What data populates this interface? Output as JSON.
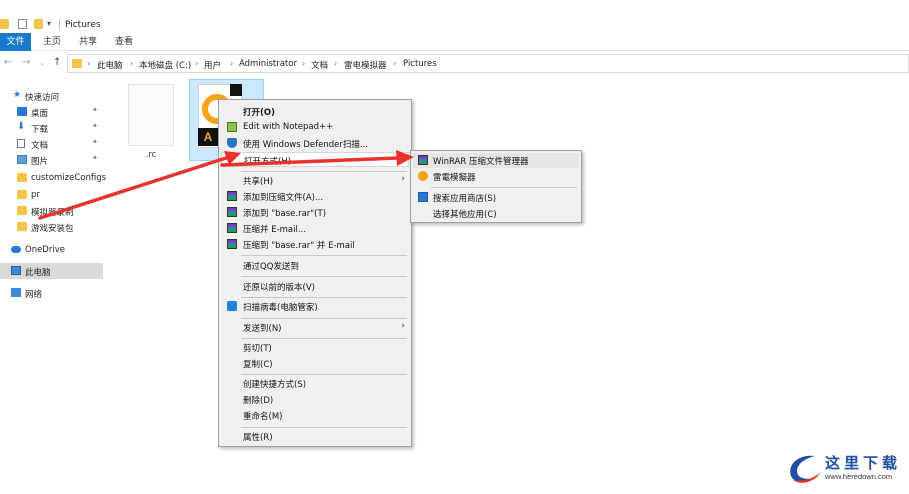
{
  "window": {
    "title": "Pictures"
  },
  "ribbon": {
    "tabs": [
      "文件",
      "主页",
      "共享",
      "查看"
    ]
  },
  "address": {
    "crumbs": [
      "此电脑",
      "本地磁盘 (C:)",
      "用户",
      "Administrator",
      "文档",
      "雷电模拟器",
      "Pictures"
    ]
  },
  "nav": {
    "items": [
      {
        "label": "快速访问",
        "icon": "star-icon",
        "pinned": false
      },
      {
        "label": "桌面",
        "icon": "desktop-icon",
        "pinned": true
      },
      {
        "label": "下载",
        "icon": "download-icon",
        "pinned": true
      },
      {
        "label": "文档",
        "icon": "document-icon",
        "pinned": true
      },
      {
        "label": "图片",
        "icon": "picture-icon",
        "pinned": true
      },
      {
        "label": "customizeConfigs",
        "icon": "folder-icon",
        "pinned": false
      },
      {
        "label": "pr",
        "icon": "folder-icon",
        "pinned": false
      },
      {
        "label": "模拟器录制",
        "icon": "folder-icon",
        "pinned": false
      },
      {
        "label": "游戏安装包",
        "icon": "folder-icon",
        "pinned": false
      },
      {
        "label": "OneDrive",
        "icon": "cloud-icon",
        "pinned": false
      },
      {
        "label": "此电脑",
        "icon": "computer-icon",
        "pinned": false,
        "selected": true
      },
      {
        "label": "网络",
        "icon": "network-icon",
        "pinned": false
      }
    ]
  },
  "files": [
    {
      "label": ".rc"
    }
  ],
  "context_menu": {
    "open": "打开(O)",
    "notepad": "Edit with Notepad++",
    "defender": "使用 Windows Defender扫描...",
    "open_with": "打开方式(H)",
    "share": "共享(H)",
    "add_archive": "添加到压缩文件(A)...",
    "add_base": "添加到 \"base.rar\"(T)",
    "compress_email": "压缩并 E-mail...",
    "compress_base_email": "压缩到 \"base.rar\" 并 E-mail",
    "qq_send": "通过QQ发送到",
    "restore": "还原以前的版本(V)",
    "scan": "扫描病毒(电脑管家)",
    "send_to": "发送到(N)",
    "cut": "剪切(T)",
    "copy": "复制(C)",
    "shortcut": "创建快捷方式(S)",
    "delete": "删除(D)",
    "rename": "重命名(M)",
    "properties": "属性(R)"
  },
  "submenu": {
    "winrar": "WinRAR 压缩文件管理器",
    "leidian": "雷電模擬器",
    "store": "搜索应用商店(S)",
    "other": "选择其他应用(C)"
  },
  "watermark": {
    "title": "这里下载",
    "url": "www.heredown.com"
  },
  "colors": {
    "accent": "#1979ca",
    "selection": "#cce8ff",
    "arrow": "#e8332d"
  }
}
